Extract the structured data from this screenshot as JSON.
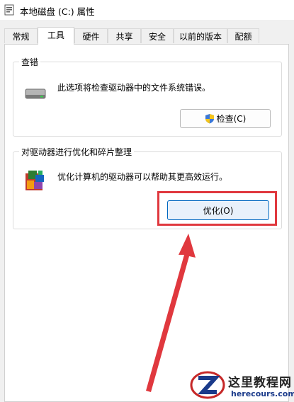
{
  "window": {
    "title": "本地磁盘 (C:) 属性"
  },
  "tabs": [
    {
      "label": "常规"
    },
    {
      "label": "工具",
      "active": true
    },
    {
      "label": "硬件"
    },
    {
      "label": "共享"
    },
    {
      "label": "安全"
    },
    {
      "label": "以前的版本"
    },
    {
      "label": "配额"
    }
  ],
  "error_check": {
    "title": "查错",
    "description": "此选项将检查驱动器中的文件系统错误。",
    "button_label": "检查(C)",
    "icon": "drive-icon",
    "button_icon": "shield-icon"
  },
  "optimize": {
    "title": "对驱动器进行优化和碎片整理",
    "description": "优化计算机的驱动器可以帮助其更高效运行。",
    "button_label": "优化(O)",
    "icon": "defrag-icon"
  },
  "annotation": {
    "highlight_color": "#e0383e",
    "arrow_color": "#e0383e"
  },
  "watermark": {
    "site_name": "这里教程网",
    "url": "herecours.com"
  }
}
